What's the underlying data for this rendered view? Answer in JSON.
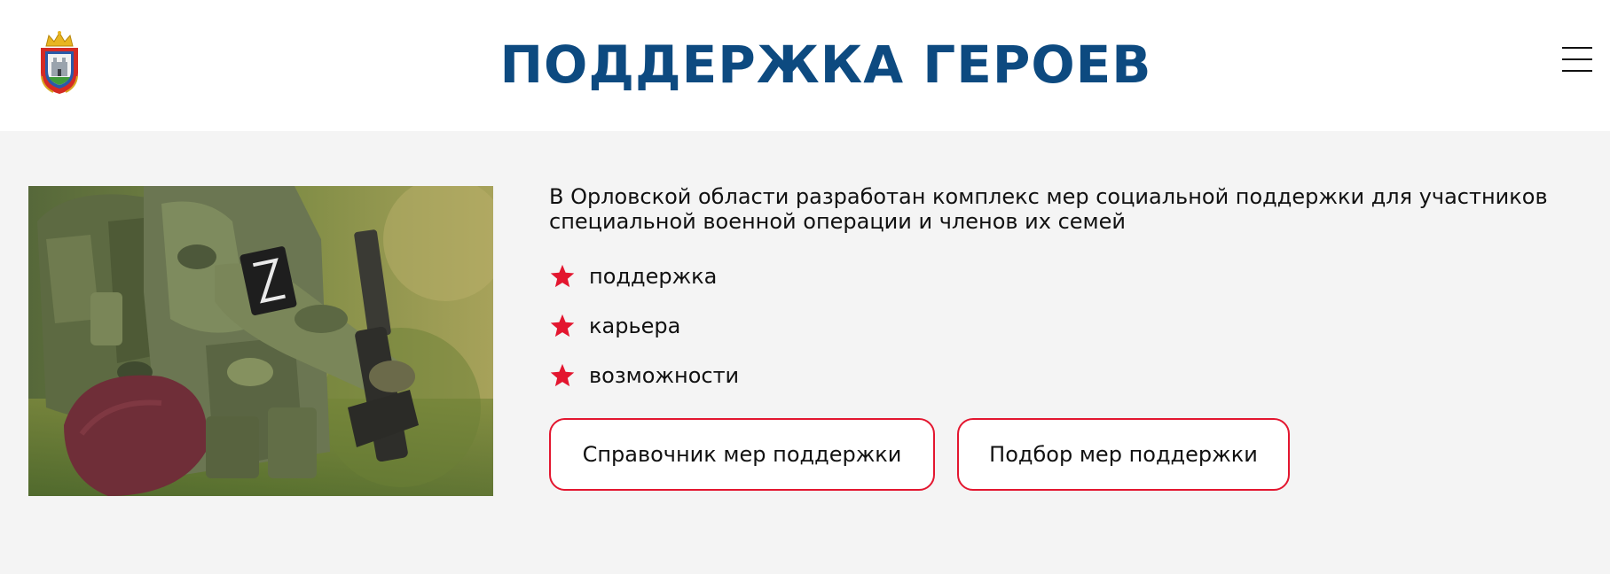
{
  "header": {
    "title": "ПОДДЕРЖКА ГЕРОЕВ",
    "logo_icon": "orel-oblast-coat-of-arms-icon",
    "menu_icon": "hamburger-menu-icon"
  },
  "hero": {
    "image_icon": "soldier-photo"
  },
  "main": {
    "intro": "В Орловской области разработан комплекс мер социальной поддержки для участников специальной военной операции и членов их семей",
    "features": [
      {
        "label": "поддержка",
        "icon": "star-icon"
      },
      {
        "label": "карьера",
        "icon": "star-icon"
      },
      {
        "label": "возможности",
        "icon": "star-icon"
      }
    ],
    "buttons": [
      {
        "label": "Справочник мер поддержки"
      },
      {
        "label": "Подбор мер поддержки"
      }
    ]
  },
  "colors": {
    "title_blue": "#0d4a80",
    "accent_red": "#e3162f",
    "background": "#f4f4f4"
  }
}
